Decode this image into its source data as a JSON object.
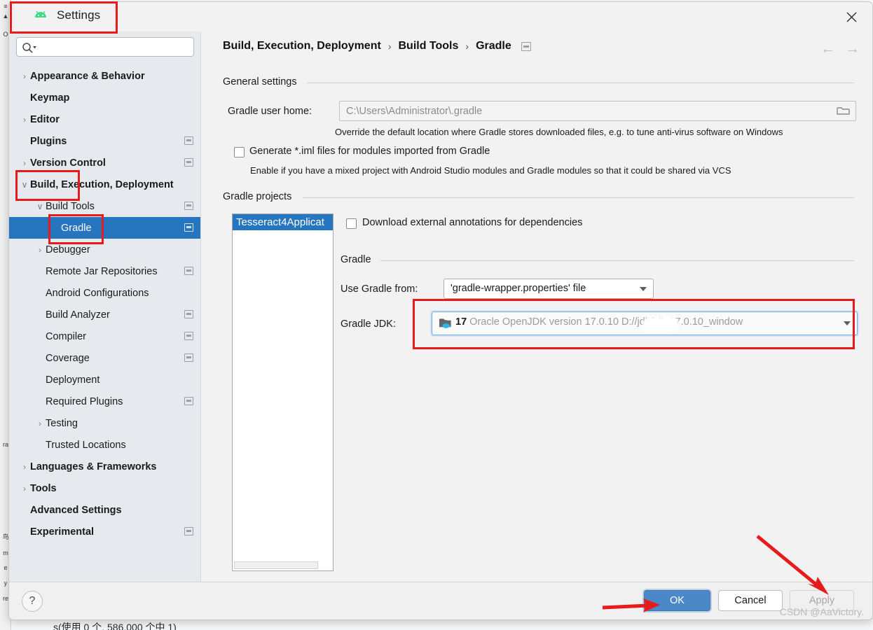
{
  "window": {
    "title": "Settings",
    "app_icon": "android-icon",
    "close_icon": "close-icon"
  },
  "sidebar": {
    "search": {
      "placeholder": "",
      "value": "",
      "icon": "search-icon"
    },
    "items": [
      {
        "label": "Appearance & Behavior",
        "depth": 0,
        "twisty": "collapsed",
        "bold": true,
        "badge": false,
        "selected": false
      },
      {
        "label": "Keymap",
        "depth": 0,
        "twisty": "none",
        "bold": true,
        "badge": false,
        "selected": false
      },
      {
        "label": "Editor",
        "depth": 0,
        "twisty": "collapsed",
        "bold": true,
        "badge": false,
        "selected": false
      },
      {
        "label": "Plugins",
        "depth": 0,
        "twisty": "none",
        "bold": true,
        "badge": true,
        "selected": false
      },
      {
        "label": "Version Control",
        "depth": 0,
        "twisty": "collapsed",
        "bold": true,
        "badge": true,
        "selected": false
      },
      {
        "label": "Build, Execution, Deployment",
        "depth": 0,
        "twisty": "expanded",
        "bold": true,
        "badge": false,
        "selected": false
      },
      {
        "label": "Build Tools",
        "depth": 1,
        "twisty": "expanded",
        "bold": false,
        "badge": true,
        "selected": false
      },
      {
        "label": "Gradle",
        "depth": 2,
        "twisty": "none",
        "bold": false,
        "badge": true,
        "selected": true
      },
      {
        "label": "Debugger",
        "depth": 1,
        "twisty": "collapsed",
        "bold": false,
        "badge": false,
        "selected": false
      },
      {
        "label": "Remote Jar Repositories",
        "depth": 1,
        "twisty": "none",
        "bold": false,
        "badge": true,
        "selected": false
      },
      {
        "label": "Android Configurations",
        "depth": 1,
        "twisty": "none",
        "bold": false,
        "badge": false,
        "selected": false
      },
      {
        "label": "Build Analyzer",
        "depth": 1,
        "twisty": "none",
        "bold": false,
        "badge": true,
        "selected": false
      },
      {
        "label": "Compiler",
        "depth": 1,
        "twisty": "none",
        "bold": false,
        "badge": true,
        "selected": false
      },
      {
        "label": "Coverage",
        "depth": 1,
        "twisty": "none",
        "bold": false,
        "badge": true,
        "selected": false
      },
      {
        "label": "Deployment",
        "depth": 1,
        "twisty": "none",
        "bold": false,
        "badge": false,
        "selected": false
      },
      {
        "label": "Required Plugins",
        "depth": 1,
        "twisty": "none",
        "bold": false,
        "badge": true,
        "selected": false
      },
      {
        "label": "Testing",
        "depth": 1,
        "twisty": "collapsed",
        "bold": false,
        "badge": false,
        "selected": false
      },
      {
        "label": "Trusted Locations",
        "depth": 1,
        "twisty": "none",
        "bold": false,
        "badge": false,
        "selected": false
      },
      {
        "label": "Languages & Frameworks",
        "depth": 0,
        "twisty": "collapsed",
        "bold": true,
        "badge": false,
        "selected": false
      },
      {
        "label": "Tools",
        "depth": 0,
        "twisty": "collapsed",
        "bold": true,
        "badge": false,
        "selected": false
      },
      {
        "label": "Advanced Settings",
        "depth": 0,
        "twisty": "none",
        "bold": true,
        "badge": false,
        "selected": false
      },
      {
        "label": "Experimental",
        "depth": 0,
        "twisty": "none",
        "bold": true,
        "badge": true,
        "selected": false
      }
    ]
  },
  "breadcrumb": {
    "part1": "Build, Execution, Deployment",
    "sep1": "›",
    "part2": "Build Tools",
    "sep2": "›",
    "part3": "Gradle",
    "badge": "settings-badge-icon"
  },
  "nav": {
    "back": "←",
    "forward": "→"
  },
  "main": {
    "general_settings": {
      "title": "General settings",
      "gradle_user_home_label": "Gradle user home:",
      "gradle_user_home_value": "C:\\Users\\Administrator\\.gradle",
      "gradle_user_home_hint": "Override the default location where Gradle stores downloaded files, e.g. to tune anti-virus software on Windows",
      "folder_icon": "folder-browse-icon",
      "generate_iml_label": "Generate *.iml files for modules imported from Gradle",
      "generate_iml_checked": false,
      "generate_iml_hint": "Enable if you have a mixed project with Android Studio modules and Gradle modules so that it could be shared via VCS"
    },
    "gradle_projects": {
      "title": "Gradle projects",
      "project_items": [
        "Tesseract4Applicat"
      ],
      "download_annotations_label": "Download external annotations for dependencies",
      "download_annotations_checked": false
    },
    "gradle_section": {
      "title": "Gradle",
      "use_gradle_from_label": "Use Gradle from:",
      "use_gradle_from_value": "'gradle-wrapper.properties' file",
      "gradle_jdk_label": "Gradle JDK:",
      "gradle_jdk_version": "17",
      "gradle_jdk_desc_pre": "Oracle OpenJDK version 17.0.10 D:/",
      "gradle_jdk_desc_post": "/jdk/jdk-17.0.10_window",
      "gradle_jdk_icon": "jdk-folder-icon"
    }
  },
  "footer": {
    "help_label": "?",
    "ok_label": "OK",
    "cancel_label": "Cancel",
    "apply_label": "Apply",
    "apply_enabled": false,
    "watermark": "CSDN @AaVictory."
  },
  "annotations": {
    "highlight_title": "Settings title highlighted",
    "highlight_build_exec": "Build, Execution, Deployment highlighted",
    "highlight_gradle_item": "Gradle tree item highlighted",
    "highlight_jdk_combo": "Gradle JDK combo highlighted",
    "arrow_ok": "arrow pointing to OK button",
    "arrow_apply": "arrow pointing to Apply button",
    "color": "#e81b1b"
  },
  "background": {
    "strip_chars": [
      "≡",
      "▲",
      "O",
      "ra",
      "鸟",
      "m",
      "e",
      "y",
      "re"
    ],
    "bottom_text": "s(使用 0 个, 586,000 个中 1)"
  }
}
